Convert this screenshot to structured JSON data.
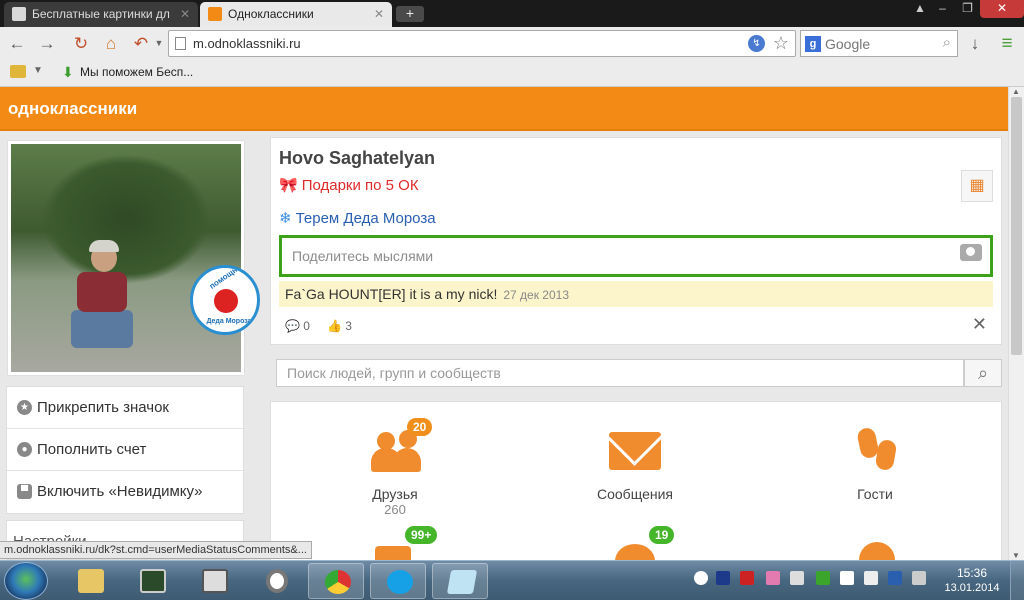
{
  "browser": {
    "tabs": [
      {
        "label": "Бесплатные картинки дл",
        "active": false
      },
      {
        "label": "Одноклассники",
        "active": true
      }
    ],
    "new_tab": "+",
    "url": "m.odnoklassniki.ru",
    "search_engine": "Google",
    "bookmark_label": "Мы поможем Бесп..."
  },
  "site": {
    "brand": "одноклассники",
    "accent": "#f28a15"
  },
  "profile": {
    "name": "Hovo Saghatelyan",
    "gifts_link": "Подарки по 5 ОК",
    "terem_link": "Терем Деда Мороза",
    "share_placeholder": "Поделитесь мыслями",
    "status_text": "Fa`Ga HOUNT[ER] it is a my nick!",
    "status_date": "27 дек 2013",
    "comments_count": "0",
    "likes_count": "3"
  },
  "helper_badge": {
    "top_text": "помощник",
    "bottom_text": "Деда Мороза"
  },
  "left_menu": [
    {
      "label": "Прикрепить значок",
      "icon": "star-icon"
    },
    {
      "label": "Пополнить счет",
      "icon": "coins-icon"
    },
    {
      "label": "Включить «Невидимку»",
      "icon": "hat-icon"
    }
  ],
  "left_menu2": [
    {
      "label": "Настройки"
    }
  ],
  "search": {
    "placeholder": "Поиск людей, групп и сообществ"
  },
  "tiles": [
    {
      "label": "Друзья",
      "sub": "260",
      "badge": "20",
      "icon": "friends-icon"
    },
    {
      "label": "Сообщения",
      "sub": "",
      "badge": "",
      "icon": "messages-icon"
    },
    {
      "label": "Гости",
      "sub": "",
      "badge": "",
      "icon": "footprints-icon"
    }
  ],
  "tiles_row2": [
    {
      "badge": "99+",
      "badge_color": "green"
    },
    {
      "badge": "19",
      "badge_color": "green"
    },
    {
      "badge": "",
      "icon": "rating-5-icon"
    }
  ],
  "status_url": "m.odnoklassniki.ru/dk?st.cmd=userMediaStatusComments&...",
  "taskbar": {
    "time": "15:36",
    "date": "13.01.2014"
  }
}
